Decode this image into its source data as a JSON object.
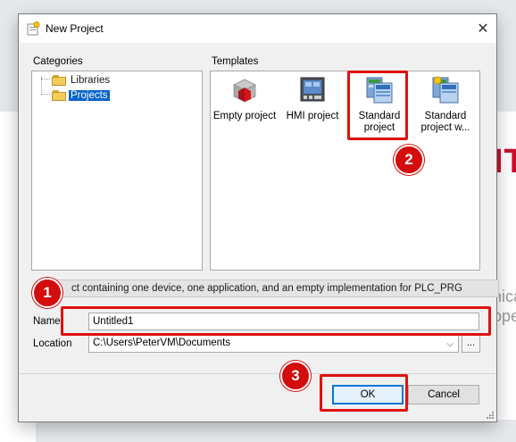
{
  "background": {
    "red_text": "IT",
    "gray_text_1": "nica",
    "gray_text_2": "oper"
  },
  "dialog": {
    "title": "New Project",
    "close_glyph": "✕",
    "categories_label": "Categories",
    "templates_label": "Templates",
    "categories": [
      {
        "label": "Libraries",
        "selected": false
      },
      {
        "label": "Projects",
        "selected": true
      }
    ],
    "templates": [
      {
        "label": "Empty project",
        "icon": "empty-project-icon"
      },
      {
        "label": "HMI project",
        "icon": "hmi-project-icon"
      },
      {
        "label": "Standard project",
        "icon": "standard-project-icon"
      },
      {
        "label": "Standard project w...",
        "icon": "standard-project-with-app-icon"
      }
    ],
    "description": "ct containing one device, one application, and an empty implementation for PLC_PRG",
    "name_label": "Name",
    "name_value": "Untitled1",
    "location_label": "Location",
    "location_value": "C:\\Users\\PeterVM\\Documents",
    "browse_label": "...",
    "ok_label": "OK",
    "cancel_label": "Cancel"
  },
  "annotations": {
    "badge_1": "1",
    "badge_2": "2",
    "badge_3": "3",
    "color": "#e01010"
  }
}
